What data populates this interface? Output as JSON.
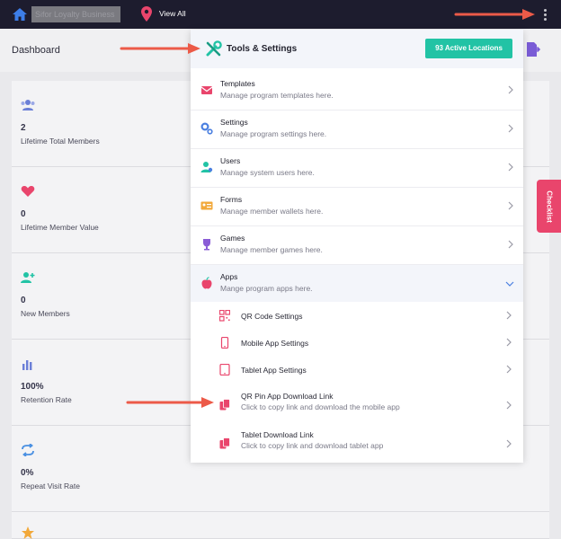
{
  "topbar": {
    "business_name": "Sifor Loyalty Business",
    "view_all": "View All"
  },
  "dashboard": {
    "title": "Dashboard",
    "stats": [
      {
        "icon": "users-icon",
        "value": "2",
        "label": "Lifetime Total Members",
        "color": "#6b7fd7"
      },
      {
        "icon": "heart-icon",
        "value": "0",
        "label": "Lifetime Member Value",
        "color": "#e9456c"
      },
      {
        "icon": "add-user-icon",
        "value": "0",
        "label": "New Members",
        "color": "#22c3a5"
      },
      {
        "icon": "bar-chart-icon",
        "value": "100%",
        "label": "Retention Rate",
        "color": "#6b7fd7"
      },
      {
        "icon": "repeat-icon",
        "value": "0%",
        "label": "Repeat Visit Rate",
        "color": "#4a90e2"
      }
    ],
    "checklist": "Checklist"
  },
  "menu": {
    "title": "Tools & Settings",
    "badge": "93 Active Locations",
    "items": [
      {
        "title": "Templates",
        "desc": "Manage program templates here.",
        "icon": "envelope-icon",
        "color": "#e9456c"
      },
      {
        "title": "Settings",
        "desc": "Manage program settings here.",
        "icon": "gears-icon",
        "color": "#4a7fe0"
      },
      {
        "title": "Users",
        "desc": "Manage system users here.",
        "icon": "user-icon",
        "color": "#22c3a5"
      },
      {
        "title": "Forms",
        "desc": "Manage member wallets here.",
        "icon": "id-card-icon",
        "color": "#f2a93b"
      },
      {
        "title": "Games",
        "desc": "Manage member games here.",
        "icon": "trophy-icon",
        "color": "#8a5cd6"
      },
      {
        "title": "Apps",
        "desc": "Mange program apps here.",
        "icon": "apple-icon",
        "color": "#e9456c"
      }
    ],
    "subitems": [
      {
        "title": "QR Code Settings",
        "desc": "",
        "icon": "qr-code-icon"
      },
      {
        "title": "Mobile App Settings",
        "desc": "",
        "icon": "mobile-icon"
      },
      {
        "title": "Tablet App Settings",
        "desc": "",
        "icon": "tablet-icon"
      },
      {
        "title": "QR Pin App Download Link",
        "desc": "Click to copy link and download the mobile app",
        "icon": "copy-icon"
      },
      {
        "title": "Tablet Download Link",
        "desc": "Click to copy link and download tablet app",
        "icon": "copy-icon"
      }
    ]
  },
  "colors": {
    "topbar": "#1d1c2e",
    "accent_teal": "#22c3a5",
    "accent_red": "#e9456c",
    "annotation_arrow": "#ec5a48"
  }
}
